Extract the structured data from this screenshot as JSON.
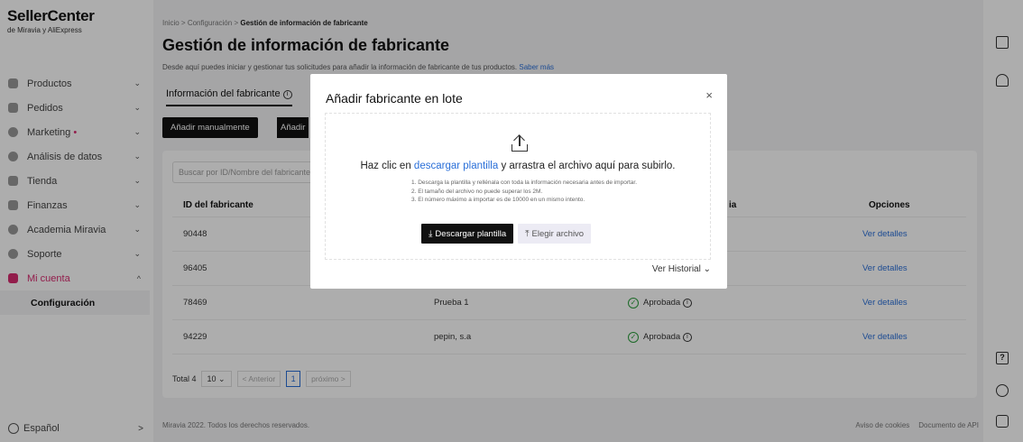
{
  "brand": {
    "title": "SellerCenter",
    "subtitle": "de Miravia y AliExpress"
  },
  "sidebar": {
    "items": [
      {
        "label": "Productos",
        "icon": "box-icon"
      },
      {
        "label": "Pedidos",
        "icon": "orders-icon"
      },
      {
        "label": "Marketing",
        "icon": "marketing-icon"
      },
      {
        "label": "Análisis de datos",
        "icon": "analytics-icon"
      },
      {
        "label": "Tienda",
        "icon": "store-icon"
      },
      {
        "label": "Finanzas",
        "icon": "finance-icon"
      },
      {
        "label": "Academia Miravia",
        "icon": "academy-icon"
      },
      {
        "label": "Soporte",
        "icon": "support-icon"
      },
      {
        "label": "Mi cuenta",
        "icon": "account-icon"
      }
    ],
    "sub_item": "Configuración",
    "language": "Español",
    "marketing_dot": "•"
  },
  "header": {
    "breadcrumb": [
      "Inicio",
      "Configuración",
      "Gestión de información de fabricante"
    ],
    "breadcrumb_sep": ">",
    "title": "Gestión de información de fabricante",
    "description": "Desde aquí puedes iniciar y gestionar tus solicitudes para añadir la información de fabricante de tus productos.",
    "learn_more": "Saber más"
  },
  "tabs": {
    "active": "Información del fabricante"
  },
  "actions": {
    "add_manual": "Añadir manualmente",
    "add_batch": "Añadir"
  },
  "search": {
    "placeholder": "Buscar por ID/Nombre del fabricante"
  },
  "table": {
    "headers": {
      "id": "ID del fabricante",
      "status": "ia",
      "options": "Opciones"
    },
    "rows": [
      {
        "id": "90448",
        "name": "",
        "status": "",
        "action": "Ver detalles"
      },
      {
        "id": "96405",
        "name": "",
        "status": "",
        "action": "Ver detalles"
      },
      {
        "id": "78469",
        "name": "Prueba 1",
        "status": "Aprobada",
        "action": "Ver detalles"
      },
      {
        "id": "94229",
        "name": "pepin, s.a",
        "status": "Aprobada",
        "action": "Ver detalles"
      }
    ]
  },
  "pagination": {
    "total": "Total 4",
    "page_size": "10",
    "prev": "< Anterior",
    "page": "1",
    "next": "próximo >"
  },
  "footer": {
    "copyright": "Miravia 2022. Todos los derechos reservados.",
    "cookies": "Aviso de cookies",
    "api_docs": "Documento de API"
  },
  "modal": {
    "title": "Añadir fabricante en lote",
    "close": "×",
    "instruction_pre": "Haz clic en",
    "instruction_link": "descargar plantilla",
    "instruction_post": "y arrastra el archivo aquí para subirlo.",
    "notes": [
      "1. Descarga la plantilla y rellénala con toda la información necesaria antes de importar.",
      "2. El tamaño del archivo no puede superar los 2M.",
      "3. El número máximo a importar es de 10000 en un mismo intento."
    ],
    "download_label": "Descargar plantilla",
    "choose_label": "Elegir archivo",
    "history_label": "Ver Historial"
  },
  "colors": {
    "accent": "#d82b6f",
    "link": "#2a6fd8",
    "success": "#2a9d3c",
    "primary_button": "#111111"
  }
}
